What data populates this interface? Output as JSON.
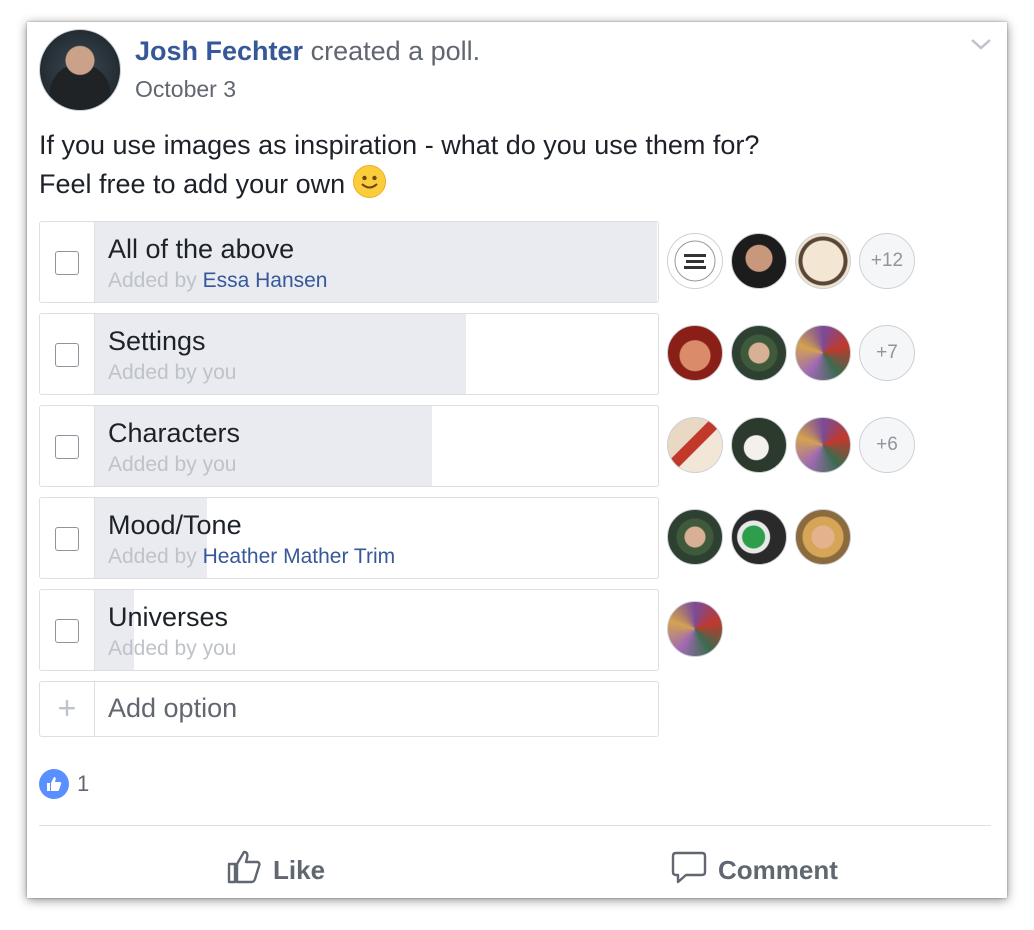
{
  "post": {
    "author": "Josh Fechter",
    "action": "created a poll.",
    "date": "October 3",
    "question_line1": "If you use images as inspiration - what do you use them for?",
    "question_line2": "Feel free to add your own"
  },
  "poll": {
    "options": [
      {
        "label": "All of the above",
        "added_prefix": "Added by",
        "added_by": "Essa Hansen",
        "added_by_is_link": true,
        "vote_share": 1.0,
        "more_voters": "+12",
        "voter_icons": [
          "writer-avatar",
          "woman-glasses-avatar",
          "emblem-avatar"
        ]
      },
      {
        "label": "Settings",
        "added_prefix": "Added by",
        "added_by": "you",
        "added_by_is_link": false,
        "vote_share": 0.66,
        "more_voters": "+7",
        "voter_icons": [
          "red-face-avatar",
          "man-cap-avatar",
          "colorful-avatar"
        ]
      },
      {
        "label": "Characters",
        "added_prefix": "Added by",
        "added_by": "you",
        "added_by_is_link": false,
        "vote_share": 0.6,
        "more_voters": "+6",
        "voter_icons": [
          "room-avatar",
          "wedding-avatar",
          "colorful-avatar"
        ]
      },
      {
        "label": "Mood/Tone",
        "added_prefix": "Added by",
        "added_by": "Heather Mather Trim",
        "added_by_is_link": true,
        "vote_share": 0.2,
        "more_voters": "",
        "voter_icons": [
          "man-cap-avatar",
          "mask-avatar",
          "blonde-woman-avatar"
        ]
      },
      {
        "label": "Universes",
        "added_prefix": "Added by",
        "added_by": "you",
        "added_by_is_link": false,
        "vote_share": 0.07,
        "more_voters": "",
        "voter_icons": [
          "colorful-avatar"
        ]
      }
    ],
    "add_option_label": "Add option"
  },
  "reactions": {
    "icon": "like-icon",
    "count": "1"
  },
  "actions": {
    "like_label": "Like",
    "comment_label": "Comment"
  },
  "colors": {
    "link": "#365899",
    "fill": "#e9ebf1",
    "like_badge": "#5890ff"
  }
}
